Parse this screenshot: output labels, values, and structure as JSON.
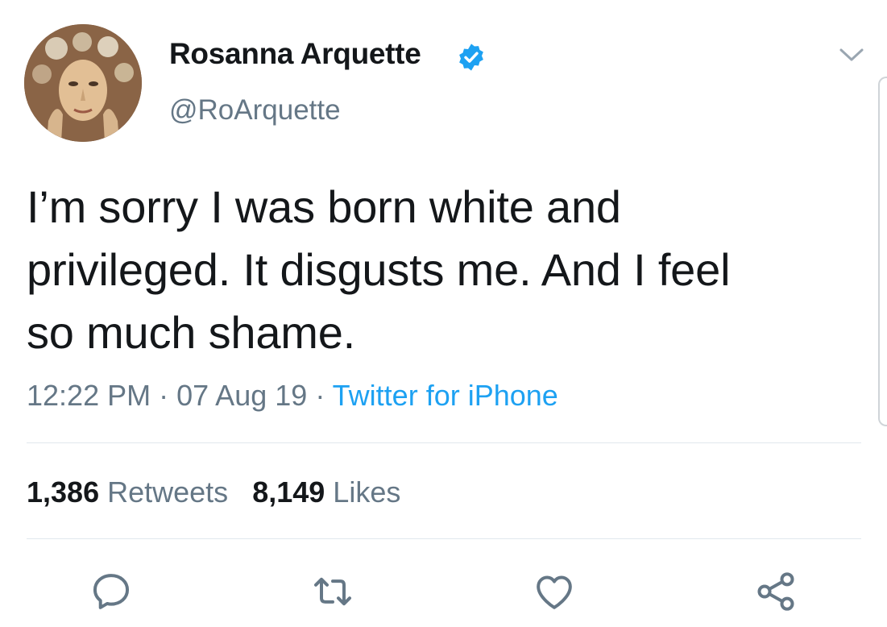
{
  "author": {
    "display_name": "Rosanna Arquette",
    "handle": "@RoArquette"
  },
  "tweet": {
    "text": "I’m sorry I was born white and\nprivileged. It disgusts me. And I feel\nso much shame.",
    "time": "12:22 PM",
    "separator": "·",
    "date": "07 Aug 19",
    "source": "Twitter for iPhone"
  },
  "stats": {
    "retweets_count": "1,386",
    "retweets_label": "Retweets",
    "likes_count": "8,149",
    "likes_label": "Likes"
  },
  "icons": {
    "verified": "verified-badge-icon",
    "menu": "chevron-down-icon",
    "reply": "reply-icon",
    "retweet": "retweet-icon",
    "like": "heart-icon",
    "share": "share-icon"
  },
  "colors": {
    "text_primary": "#14171a",
    "text_secondary": "#657786",
    "accent": "#1da1f2",
    "divider": "#e1e8ed"
  }
}
